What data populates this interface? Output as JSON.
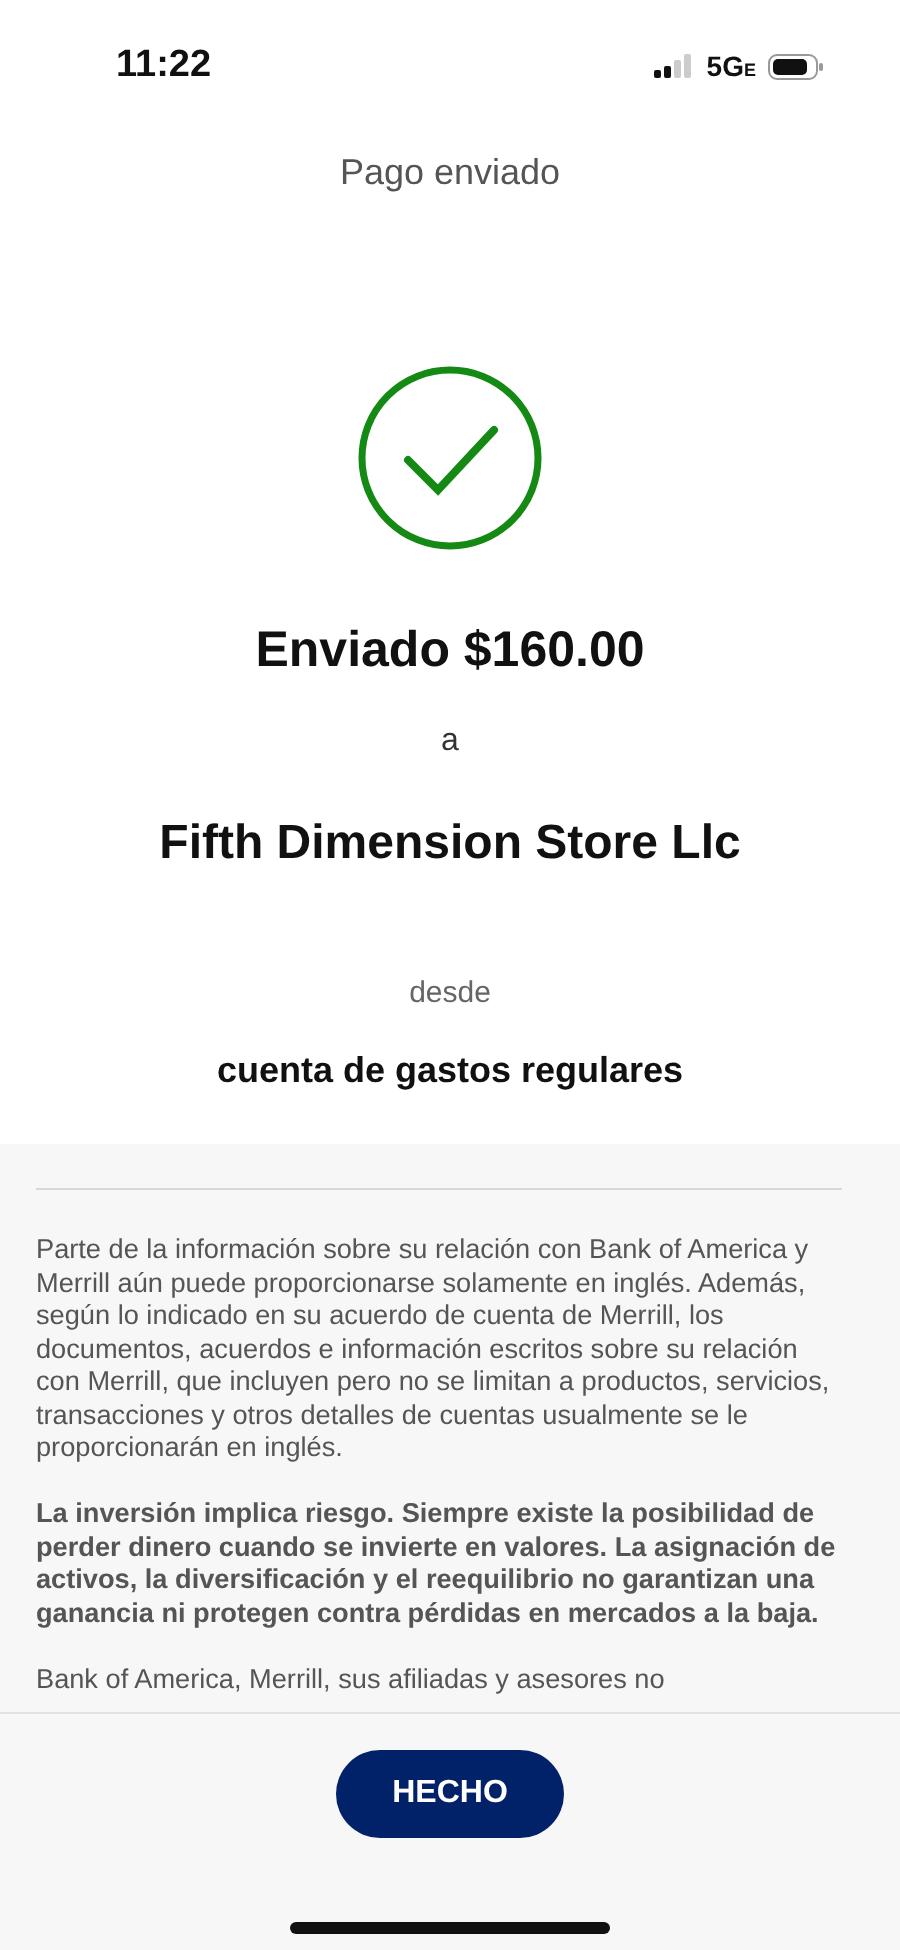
{
  "status_bar": {
    "time": "11:22",
    "network": "5G",
    "network_suffix": "E"
  },
  "header": {
    "title": "Pago enviado"
  },
  "confirmation": {
    "success": true,
    "amount_line": "Enviado $160.00",
    "to_label": "a",
    "recipient": "Fifth Dimension Store Llc",
    "from_label": "desde",
    "account": "cuenta de gastos regulares"
  },
  "disclaimer": [
    {
      "kind": "normal",
      "text": "Parte de la información sobre su relación con Bank of America y Merrill aún puede proporcionarse solamente en inglés. Además, según lo indicado en su acuerdo de cuenta de Merrill, los documentos, acuerdos e información escritos sobre su relación con Merrill, que incluyen pero no se limitan a productos, servicios, transacciones y otros detalles de cuentas usualmente se le proporcionarán en inglés."
    },
    {
      "kind": "bold",
      "text": "La inversión implica riesgo. Siempre existe la posibilidad de perder dinero cuando se invierte en valores. La asignación de activos, la diversificación y el reequilibrio no garantizan una ganancia ni protegen contra pérdidas en mercados a la baja."
    },
    {
      "kind": "normal",
      "text": "Bank of America, Merrill, sus afiliadas y asesores no"
    }
  ],
  "done_button": {
    "label": "HECHO"
  }
}
